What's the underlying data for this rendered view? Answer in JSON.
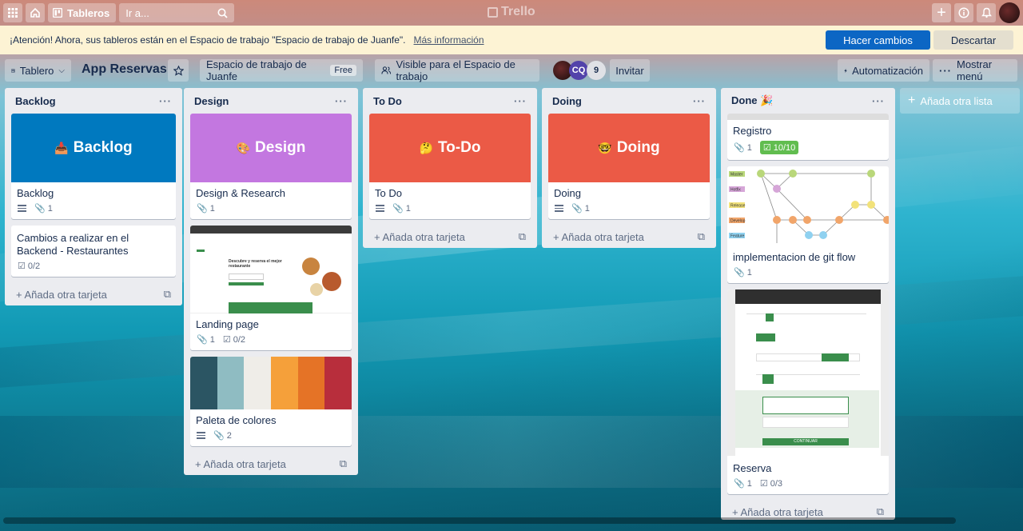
{
  "nav": {
    "apps_icon": "grid-icon",
    "home_icon": "home-icon",
    "boards_label": "Tableros",
    "search_placeholder": "Ir a...",
    "logo": "Trello"
  },
  "banner": {
    "message": "¡Atención! Ahora, sus tableros están en el Espacio de trabajo \"Espacio de trabajo de Juanfe\".",
    "more_link": "Más información",
    "primary_button": "Hacer cambios",
    "secondary_button": "Descartar"
  },
  "board": {
    "view_label": "Tablero",
    "title": "App Reservas",
    "workspace": "Espacio de trabajo de Juanfe",
    "plan": "Free",
    "visibility": "Visible para el Espacio de trabajo",
    "member_initials": "CQ",
    "member_count": "9",
    "invite": "Invitar",
    "automation": "Automatización",
    "menu": "Mostrar menú",
    "add_list": "Añada otra lista",
    "add_card": "Añada otra tarjeta"
  },
  "lists": [
    {
      "name": "Backlog",
      "cards": [
        {
          "cover_text": "Backlog",
          "cover_emoji": "📥",
          "cover_color": "#0079bf",
          "title": "Backlog",
          "description": true,
          "attachments": "1"
        },
        {
          "title": "Cambios a realizar en el Backend - Restaurantes",
          "checklist": "0/2"
        }
      ]
    },
    {
      "name": "Design",
      "cards": [
        {
          "cover_text": "Design",
          "cover_emoji": "🎨",
          "cover_color": "#c377e0",
          "title": "Design & Research",
          "attachments": "1"
        },
        {
          "title": "Landing page",
          "attachments": "1",
          "checklist": "0/2",
          "image": "landing-page-screenshot",
          "image_heading": "Descubre y reserva el mejor restaurante"
        },
        {
          "title": "Paleta de colores",
          "description": true,
          "attachments": "2",
          "palette": [
            "#2b5563",
            "#8fbcc2",
            "#efede8",
            "#f5a03a",
            "#e57326",
            "#b82e3c"
          ]
        }
      ]
    },
    {
      "name": "To Do",
      "cards": [
        {
          "cover_text": "To-Do",
          "cover_emoji": "🤔",
          "cover_color": "#eb5a46",
          "title": "To Do",
          "description": true,
          "attachments": "1"
        }
      ]
    },
    {
      "name": "Doing",
      "cards": [
        {
          "cover_text": "Doing",
          "cover_emoji": "🤓",
          "cover_color": "#eb5a46",
          "title": "Doing",
          "description": true,
          "attachments": "1"
        }
      ]
    },
    {
      "name": "Done",
      "name_emoji": "🎉",
      "cards": [
        {
          "title": "Registro",
          "attachments": "1",
          "checklist": "10/10"
        },
        {
          "title": "implementacion de git flow",
          "attachments": "1",
          "image": "git-flow-diagram",
          "branches": [
            "Master",
            "Hotfix",
            "Release",
            "Develop",
            "Feature"
          ]
        },
        {
          "title": "Reserva",
          "attachments": "1",
          "checklist": "0/3",
          "image": "reservation-screenshot",
          "image_button": "CONTINUAR"
        }
      ]
    }
  ]
}
